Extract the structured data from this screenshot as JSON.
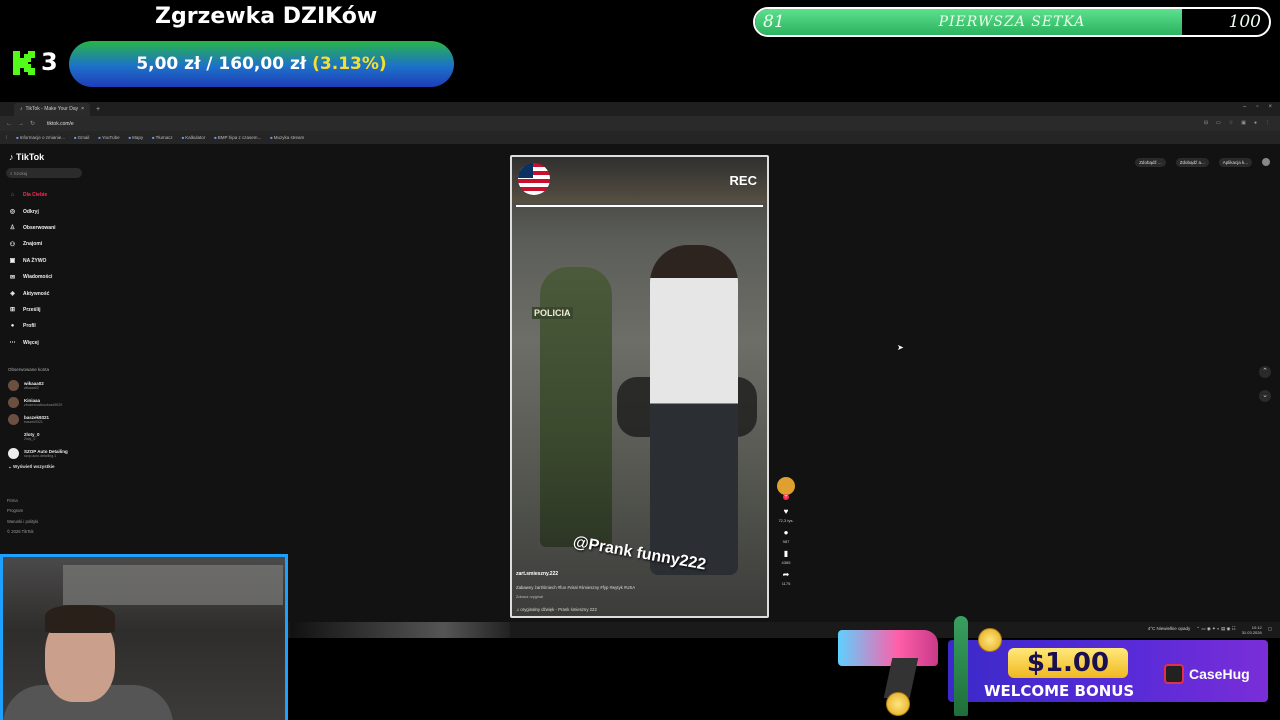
{
  "goal": {
    "title": "Zgrzewka DZIKów",
    "kick_count": "3",
    "amount": "5,00 zł / 160,00 zł",
    "percent": "(3.13%)"
  },
  "milestone": {
    "start": "81",
    "label": "PIERWSZA SETKA",
    "end": "100",
    "progress_fraction": 0.83
  },
  "browser": {
    "tab_title": "TikTok - Make Your Day",
    "url": "tiktok.com/e",
    "bookmarks": [
      "Informacje o zmianie...",
      "Gmail",
      "YouTube",
      "Mapy",
      "Tłumacz",
      "Kalkulator",
      "BMP hipa z czasem...",
      "Muzyka stream"
    ]
  },
  "tiktok": {
    "logo": "TikTok",
    "search_placeholder": "Szukaj",
    "nav": [
      {
        "label": "Dla Ciebie",
        "icon": "⌂"
      },
      {
        "label": "Odkryj",
        "icon": "◎"
      },
      {
        "label": "Obserwowani",
        "icon": "♙"
      },
      {
        "label": "Znajomi",
        "icon": "⚇"
      },
      {
        "label": "NA ŻYWO",
        "icon": "▣"
      },
      {
        "label": "Wiadomości",
        "icon": "✉"
      },
      {
        "label": "Aktywność",
        "icon": "◈"
      },
      {
        "label": "Prześlij",
        "icon": "⊞"
      },
      {
        "label": "Profil",
        "icon": "●"
      },
      {
        "label": "Więcej",
        "icon": "⋯"
      }
    ],
    "followed_section": "Obserwowane konta",
    "accounts": [
      {
        "name": "wikaaa02",
        "handle": "wikaaa02"
      },
      {
        "name": "Kiniaaa",
        "handle": "zbozezcocikuzbozd9029"
      },
      {
        "name": "baszek9321",
        "handle": "baszek9321"
      },
      {
        "name": "2loty_0",
        "handle": "2loty_0"
      },
      {
        "name": "SZOP Auto Detailing",
        "handle": "szop.auto.detailing.1"
      }
    ],
    "show_all": "Wyświetl wszystkie",
    "footer": [
      "Firma",
      "Program",
      "Warunki i polityki",
      "© 2026 TikTok"
    ],
    "top_buttons": [
      "Zdobądź ...",
      "Zdobądź a...",
      "Aplikacja k..."
    ]
  },
  "video": {
    "rec": "REC",
    "badge": "POLICIA",
    "watermark": "@Prank funny222",
    "username": "zart.smieszny.222",
    "description": "Zabawny żart/śmiech #fun #viral #śmieszny #fyp #wytyk #USA",
    "original": "Zobacz oryginał",
    "music": "♫ oryginalny dźwięk - Prank śmieszny 222",
    "likes": "72,3 tys.",
    "comments": "987",
    "saves": "4365",
    "shares": "1175"
  },
  "taskbar": {
    "weather": "4°C Niewielkie opady",
    "time": "10:12",
    "date": "31.03.2026"
  },
  "ad": {
    "amount": "$1.00",
    "bonus": "WELCOME BONUS",
    "brand": "CaseHug"
  }
}
